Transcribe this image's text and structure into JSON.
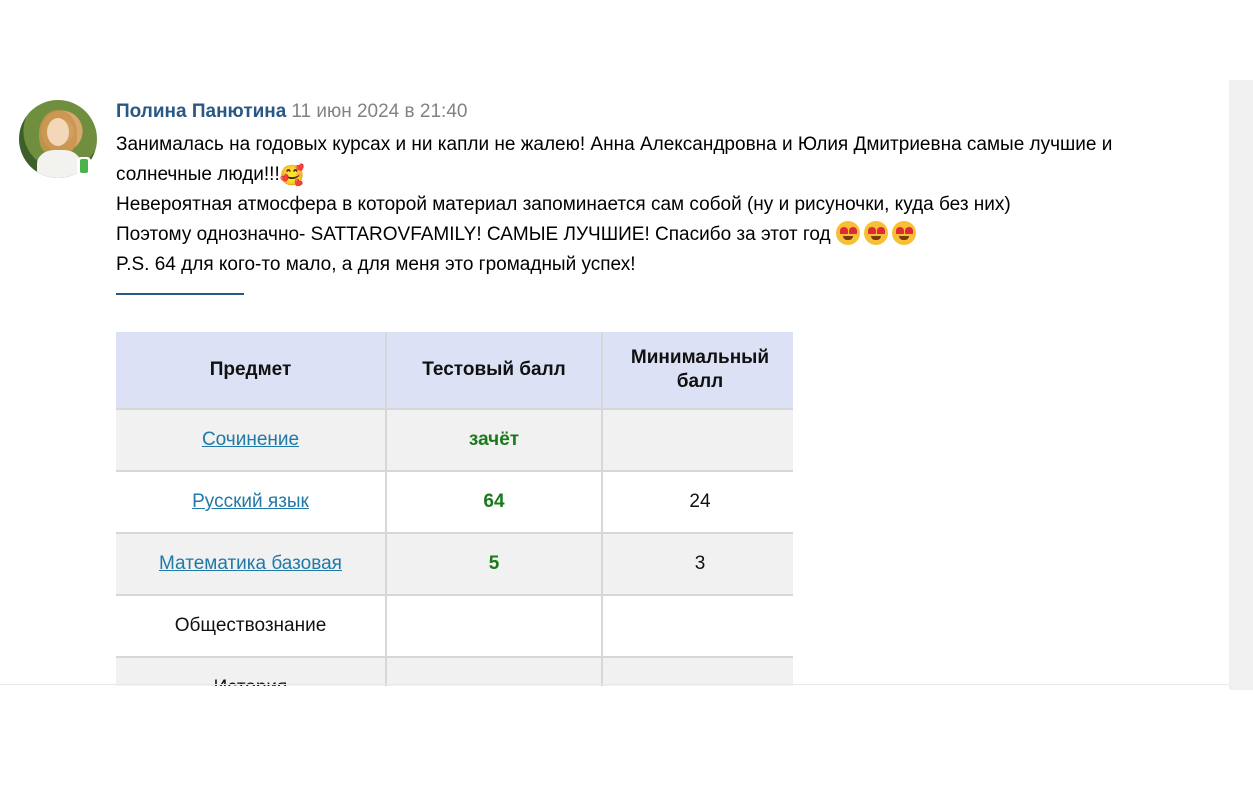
{
  "post": {
    "author": "Полина Панютина",
    "date": "11 июн 2024 в 21:40",
    "lines": [
      "Занималась на годовых курсах и ни капли не жалею! Анна Александровна и Юлия Дмитриевна самые лучшие и",
      "солнечные люди!!!",
      "Невероятная атмосфера в которой материал запоминается сам собой (ну и рисуночки, куда без них)",
      "Поэтому однозначно- SATTAROVFAMILY! САМЫЕ ЛУЧШИЕ! Спасибо за этот год ",
      "P.S. 64 для кого-то мало, а для меня это громадный успех!"
    ],
    "emojis": {
      "line2": "🥰",
      "line4": [
        "heart-eyes-emoji",
        "heart-eyes-emoji",
        "heart-eyes-emoji"
      ]
    }
  },
  "table": {
    "headers": [
      "Предмет",
      "Тестовый балл",
      "Минимальный балл"
    ],
    "rows": [
      {
        "subject": "Сочинение",
        "link": true,
        "score": "зачёт",
        "min": ""
      },
      {
        "subject": "Русский язык",
        "link": true,
        "score": "64",
        "min": "24"
      },
      {
        "subject": "Математика базовая",
        "link": true,
        "score": "5",
        "min": "3"
      },
      {
        "subject": "Обществознание",
        "link": false,
        "score": "",
        "min": ""
      },
      {
        "subject": "История",
        "link": false,
        "score": "",
        "min": ""
      }
    ]
  },
  "colors": {
    "author": "#2a5885",
    "date": "#828282",
    "header_bg": "#dce1f5",
    "link": "#2179a8",
    "score": "#1a7a1a"
  }
}
